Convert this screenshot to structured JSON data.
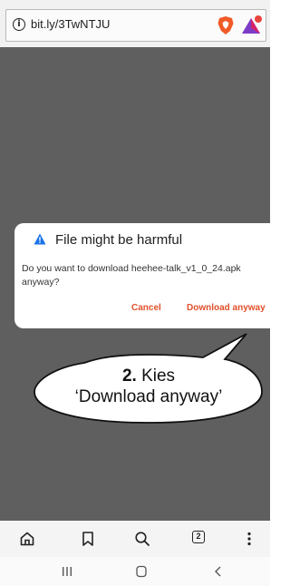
{
  "browser": {
    "url": "bit.ly/3TwNTJU",
    "tab_count": "2"
  },
  "dialog": {
    "title": "File might be harmful",
    "message": "Do you want to download heehee-talk_v1_0_24.apk anyway?",
    "cancel_label": "Cancel",
    "download_label": "Download anyway"
  },
  "callout": {
    "step_number": "2.",
    "line1": "Kies",
    "line2": "‘Download anyway’"
  },
  "colors": {
    "accent": "#e0502a",
    "overlay": "#5f5f5f",
    "warning_icon": "#1a73e8"
  },
  "toolbar": {
    "icons": [
      "home-icon",
      "bookmark-icon",
      "search-icon",
      "tabs-icon",
      "menu-icon"
    ]
  },
  "navbar": {
    "icons": [
      "recents-icon",
      "home-nav-icon",
      "back-icon"
    ]
  }
}
